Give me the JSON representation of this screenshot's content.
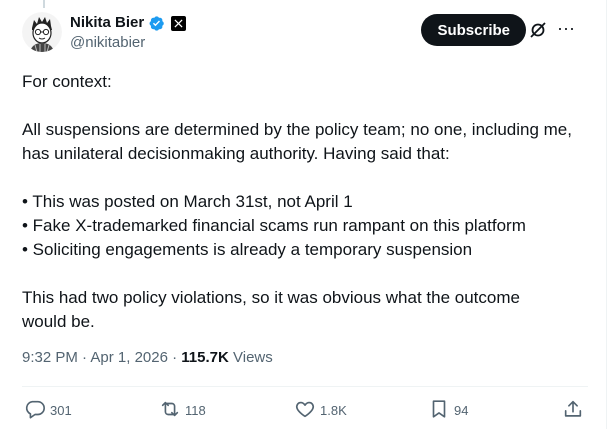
{
  "post": {
    "author": {
      "display_name": "Nikita Bier",
      "handle": "@nikitabier"
    },
    "subscribe_label": "Subscribe",
    "more_label": "···",
    "paragraphs": {
      "p1": "For context:",
      "p2a": "All suspensions are determined by the policy team; no one, including me,",
      "p2b": "has unilateral decisionmaking authority. Having said that:",
      "b1": "• This was posted on March 31st, not April 1",
      "b2": "• Fake X-trademarked financial scams run rampant on this platform",
      "b3": "• Soliciting engagements is already a temporary suspension",
      "p4a": "This had two policy violations, so it was obvious what the outcome",
      "p4b": "would be."
    },
    "meta": {
      "time": "9:32 PM",
      "sep1": " · ",
      "date": "Apr 1, 2026",
      "sep2": " · ",
      "views_count": "115.7K",
      "views_label": " Views"
    },
    "actions": {
      "replies": "301",
      "reposts": "118",
      "likes": "1.8K",
      "bookmarks": "94"
    },
    "colors": {
      "verified": "#1d9bf0",
      "text": "#0f1419",
      "secondary": "#536471",
      "button_bg": "#0f1419"
    }
  }
}
